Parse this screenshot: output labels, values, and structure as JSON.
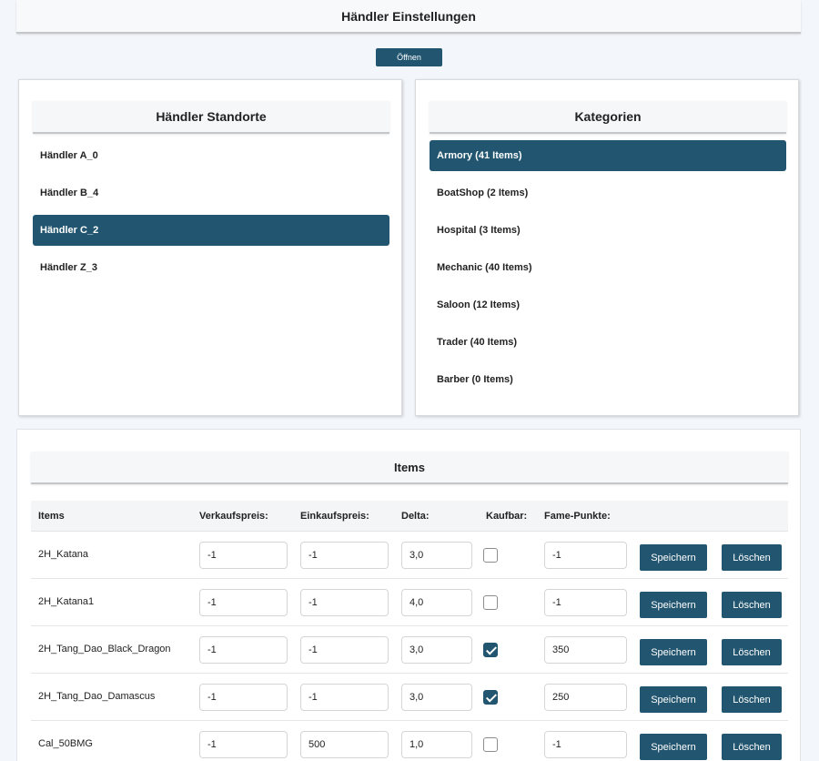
{
  "header": {
    "title": "Händler Einstellungen",
    "open_button": "Öffnen"
  },
  "locations": {
    "title": "Händler Standorte",
    "items": [
      {
        "label": "Händler A_0",
        "active": false
      },
      {
        "label": "Händler B_4",
        "active": false
      },
      {
        "label": "Händler C_2",
        "active": true
      },
      {
        "label": "Händler Z_3",
        "active": false
      }
    ]
  },
  "categories": {
    "title": "Kategorien",
    "items": [
      {
        "label": "Armory (41 Items)",
        "active": true
      },
      {
        "label": "BoatShop (2 Items)",
        "active": false
      },
      {
        "label": "Hospital (3 Items)",
        "active": false
      },
      {
        "label": "Mechanic (40 Items)",
        "active": false
      },
      {
        "label": "Saloon (12 Items)",
        "active": false
      },
      {
        "label": "Trader (40 Items)",
        "active": false
      },
      {
        "label": "Barber (0 Items)",
        "active": false
      }
    ]
  },
  "items": {
    "title": "Items",
    "columns": {
      "items": "Items",
      "sell": "Verkaufspreis:",
      "buy": "Einkaufspreis:",
      "delta": "Delta:",
      "buyable": "Kaufbar:",
      "fame": "Fame-Punkte:"
    },
    "save_label": "Speichern",
    "delete_label": "Löschen",
    "rows": [
      {
        "name": "2H_Katana",
        "sell": "-1",
        "buy": "-1",
        "delta": "3,0",
        "buyable": false,
        "fame": "-1"
      },
      {
        "name": "2H_Katana1",
        "sell": "-1",
        "buy": "-1",
        "delta": "4,0",
        "buyable": false,
        "fame": "-1"
      },
      {
        "name": "2H_Tang_Dao_Black_Dragon",
        "sell": "-1",
        "buy": "-1",
        "delta": "3,0",
        "buyable": true,
        "fame": "350"
      },
      {
        "name": "2H_Tang_Dao_Damascus",
        "sell": "-1",
        "buy": "-1",
        "delta": "3,0",
        "buyable": true,
        "fame": "250"
      },
      {
        "name": "Cal_50BMG",
        "sell": "-1",
        "buy": "500",
        "delta": "1,0",
        "buyable": false,
        "fame": "-1"
      }
    ]
  }
}
